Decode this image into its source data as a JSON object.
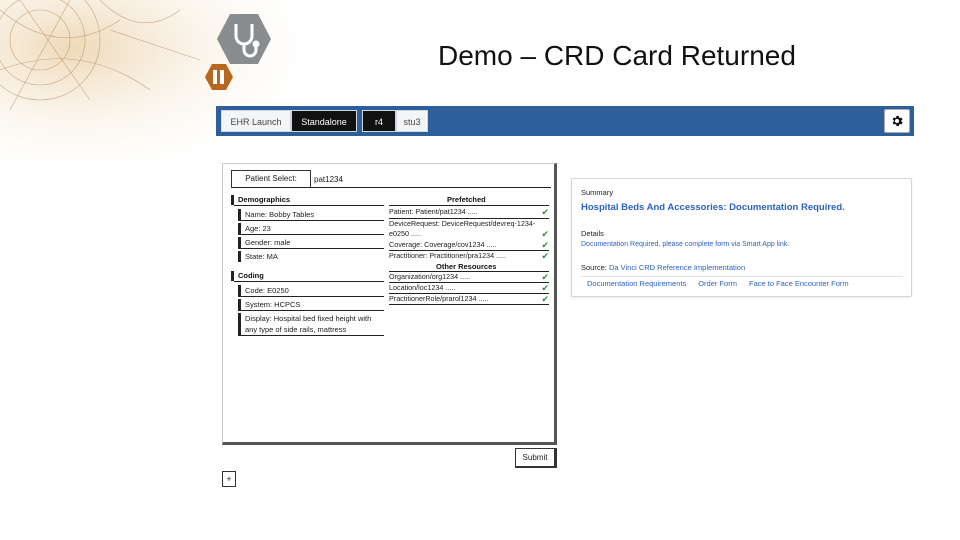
{
  "slide": {
    "title": "Demo – CRD Card Returned"
  },
  "toolbar": {
    "tabs": [
      {
        "label": "EHR Launch",
        "active": false
      },
      {
        "label": "Standalone",
        "active": true
      },
      {
        "label": "r4",
        "active": true
      },
      {
        "label": "stu3",
        "active": false
      }
    ],
    "settings_icon": "gear-icon"
  },
  "form": {
    "patient_select_label": "Patient Select:",
    "patient_select_value": "pat1234",
    "demographics": {
      "heading": "Demographics",
      "fields": [
        "Name: Bobby Tables",
        "Age: 23",
        "Gender: male",
        "State: MA"
      ]
    },
    "coding": {
      "heading": "Coding",
      "fields": [
        "Code: E0250",
        "System: HCPCS",
        "Display: Hospital bed fixed height with any type of side rails, mattress"
      ]
    },
    "prefetched": {
      "heading": "Prefetched",
      "items": [
        "Patient: Patient/pat1234 .....",
        "DeviceRequest: DeviceRequest/devreq-1234-e0250 .....",
        "Coverage: Coverage/cov1234 .....",
        "Practitioner: Practitioner/pra1234 ....."
      ]
    },
    "other_resources": {
      "heading": "Other Resources",
      "items": [
        "Organization/org1234 .....",
        "Location/loc1234 .....",
        "PractitionerRole/prarol1234 ....."
      ]
    },
    "submit_label": "Submit",
    "add_label": "+"
  },
  "card": {
    "summary_label": "Summary",
    "summary": "Hospital Beds And Accessories: Documentation Required.",
    "details_label": "Details",
    "detail": "Documentation Required, please complete form via Smart App link.",
    "source_label": "Source:",
    "source": "Da Vinci CRD Reference Implementation",
    "links": [
      "Documentation Requirements",
      "Order Form",
      "Face to Face Encounter Form"
    ]
  },
  "colors": {
    "toolbar": "#2f5f9a",
    "link": "#2b63c4",
    "check": "#2e8b3d",
    "logo_hex": "#8a8d90",
    "logo_hex2": "#b8671f"
  }
}
